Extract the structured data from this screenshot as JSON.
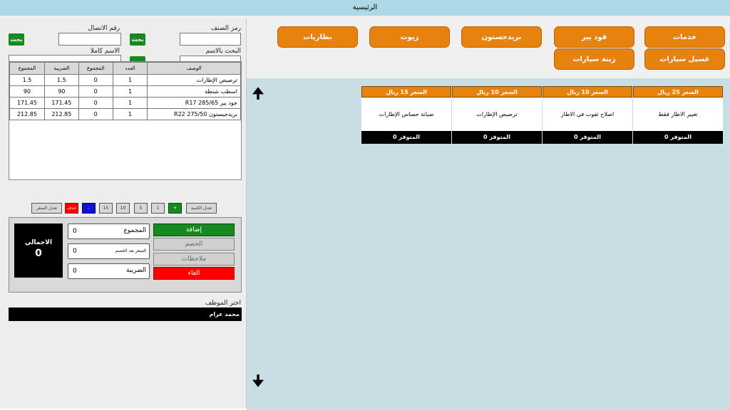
{
  "window": {
    "title": "الرئيسية"
  },
  "search": {
    "item_code_label": "رمز الصنف",
    "phone_label": "رقم الاتصال",
    "name_search_label": "البحث بالاسم",
    "full_name_label": "الاسم كاملا",
    "search_btn": "بحث",
    "item_code_value": "",
    "phone_value": "",
    "name_search_value": "",
    "full_name_value": ""
  },
  "items_table": {
    "headers": [
      "الوصف",
      "العدد",
      "المجموع",
      "الضريبة",
      "المجموع"
    ],
    "rows": [
      {
        "desc": "ترصيص الإطارات",
        "qty": "1",
        "sum": "0",
        "tax": "1.5",
        "total": "1.5"
      },
      {
        "desc": "اسطب شنطة",
        "qty": "1",
        "sum": "0",
        "tax": "90",
        "total": "90"
      },
      {
        "desc": "جود يير R17 285/65",
        "qty": "1",
        "sum": "0",
        "tax": "171.45",
        "total": "171.45"
      },
      {
        "desc": "بريدجيستون R22 275/50",
        "qty": "1",
        "sum": "0",
        "tax": "212.85",
        "total": "212.85"
      }
    ]
  },
  "qty_buttons": {
    "edit_qty": "تعدل الكمية",
    "plus": "+",
    "n1": "1",
    "n5": "5",
    "n10": "10",
    "n15": "15",
    "minus": "-",
    "delete": "حذف",
    "edit_price": "تعدل السعر"
  },
  "totals": {
    "grand_label": "الاجمالي",
    "grand_value": "0",
    "sum_label": "المجموع",
    "sum_value": "0",
    "after_discount_label": "السعر بعد الخصم",
    "after_discount_value": "0",
    "tax_label": "الضريبة",
    "tax_value": "0"
  },
  "actions": {
    "add": "إضافة",
    "discount": "الخصم",
    "notes": "ملاحظات",
    "cancel": "الغاء"
  },
  "employee": {
    "label": "اختر الموظف",
    "selected": "محمد عزام"
  },
  "categories": [
    "خدمات",
    "قود يير",
    "بريدجستون",
    "زيوت",
    "بطاريات",
    "غسيل سيارات",
    "زينة سيارات"
  ],
  "products": [
    {
      "price": "السعر 25 ريال",
      "name": "تغيير الاطار فقط",
      "stock": "المتوفر 0"
    },
    {
      "price": "السعر 10 ريال",
      "name": "اصلاح ثقوب في الاطار",
      "stock": "المتوفر 0"
    },
    {
      "price": "السعر 10 ريال",
      "name": "ترصيص الإطارات",
      "stock": "المتوفر 0"
    },
    {
      "price": "السعر 15 ريال",
      "name": "صيانة حساس الإطارات",
      "stock": "المتوفر 0"
    }
  ],
  "colors": {
    "accent_orange": "#e8820e",
    "search_green": "#168a1e",
    "cancel_red": "#ff0000",
    "titlebar_blue": "#add8e6",
    "panel_blue": "#c8dde4"
  },
  "icons": {
    "scroll_up": "up-arrow-icon",
    "scroll_down": "down-arrow-icon"
  }
}
